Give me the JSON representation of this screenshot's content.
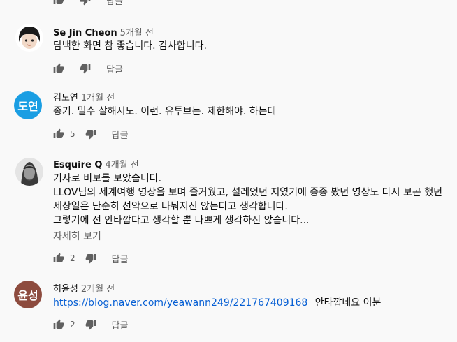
{
  "comments": [
    {
      "author": "",
      "time": "",
      "lines": [],
      "likes": "",
      "reply_label": "답글"
    },
    {
      "author": "Se Jin Cheon",
      "time": "5개월 전",
      "lines": [
        "담백한 화면 참 좋습니다. 감사합니다."
      ],
      "likes": "",
      "reply_label": "답글",
      "avatar": {
        "type": "photo",
        "bg": "#ffffff"
      }
    },
    {
      "author": "김도연",
      "time": "1개월 전",
      "lines": [
        "종기. 밀수 살해시도. 이런. 유투브는. 제한해야. 하는데"
      ],
      "likes": "5",
      "reply_label": "답글",
      "avatar": {
        "type": "initials",
        "initials": "도연",
        "bg": "#1a9ee3"
      }
    },
    {
      "author": "Esquire Q",
      "time": "4개월 전",
      "lines": [
        "기사로 비보를 보았습니다.",
        "LLOV님의 세계여행 영상을 보며 즐거웠고, 설레었던 저였기에 종종 봤던 영상도 다시 보곤 했던",
        "세상일은 단순히 선악으로 나눠지진 않는다고 생각합니다.",
        "그렇기에 전 안타깝다고 생각할 뿐 나쁘게 생각하진 않습니다..."
      ],
      "more_label": "자세히 보기",
      "likes": "2",
      "reply_label": "답글",
      "avatar": {
        "type": "photo",
        "bg": "#dcdcdc"
      }
    },
    {
      "author": "허윤성",
      "time": "2개월 전",
      "link": "https://blog.naver.com/yeawann249/221767409168",
      "text_after_link": "안타깝네요 이분",
      "likes": "2",
      "reply_label": "답글",
      "avatar": {
        "type": "initials",
        "initials": "윤성",
        "bg": "#8d4b3e"
      }
    }
  ],
  "icons": {
    "like": "thumbs-up-icon",
    "dislike": "thumbs-down-icon"
  },
  "colors": {
    "link": "#065fd4",
    "secondary_text": "#606060",
    "background": "#f9f9f9"
  }
}
